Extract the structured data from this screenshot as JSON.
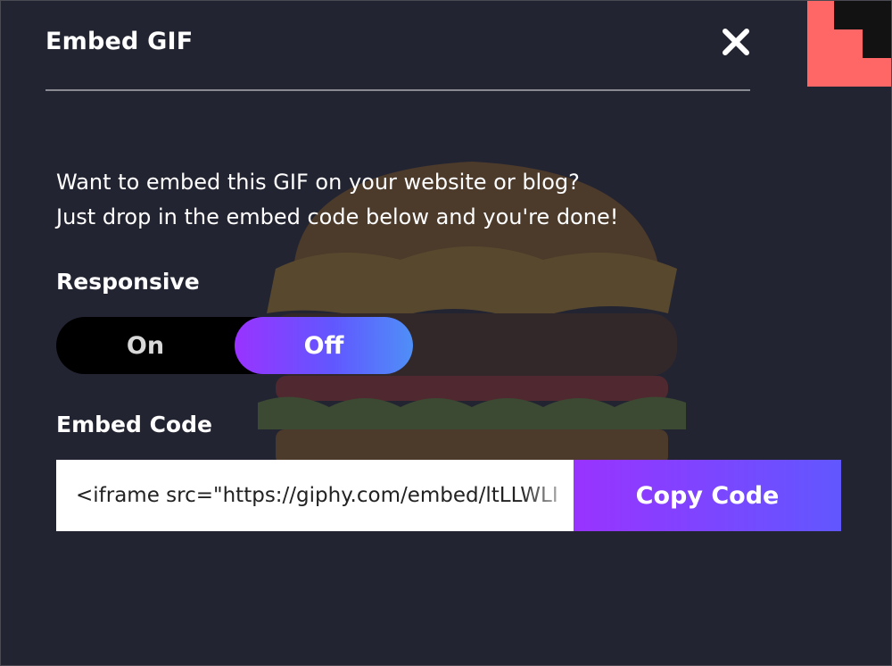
{
  "dialog": {
    "title": "Embed GIF",
    "close_icon": "close-icon"
  },
  "description": {
    "line1": "Want to embed this GIF on your website or blog?",
    "line2": "Just drop in the embed code below and you're done!"
  },
  "responsive": {
    "label": "Responsive",
    "on_label": "On",
    "off_label": "Off",
    "selected": "Off"
  },
  "embed_code": {
    "label": "Embed Code",
    "value": "<iframe src=\"https://giphy.com/embed/ltLLWLI",
    "copy_label": "Copy Code"
  },
  "colors": {
    "background": "#232431",
    "accent_start": "#9933ff",
    "accent_end": "#6157ff",
    "corner_pink": "#ff6666"
  }
}
